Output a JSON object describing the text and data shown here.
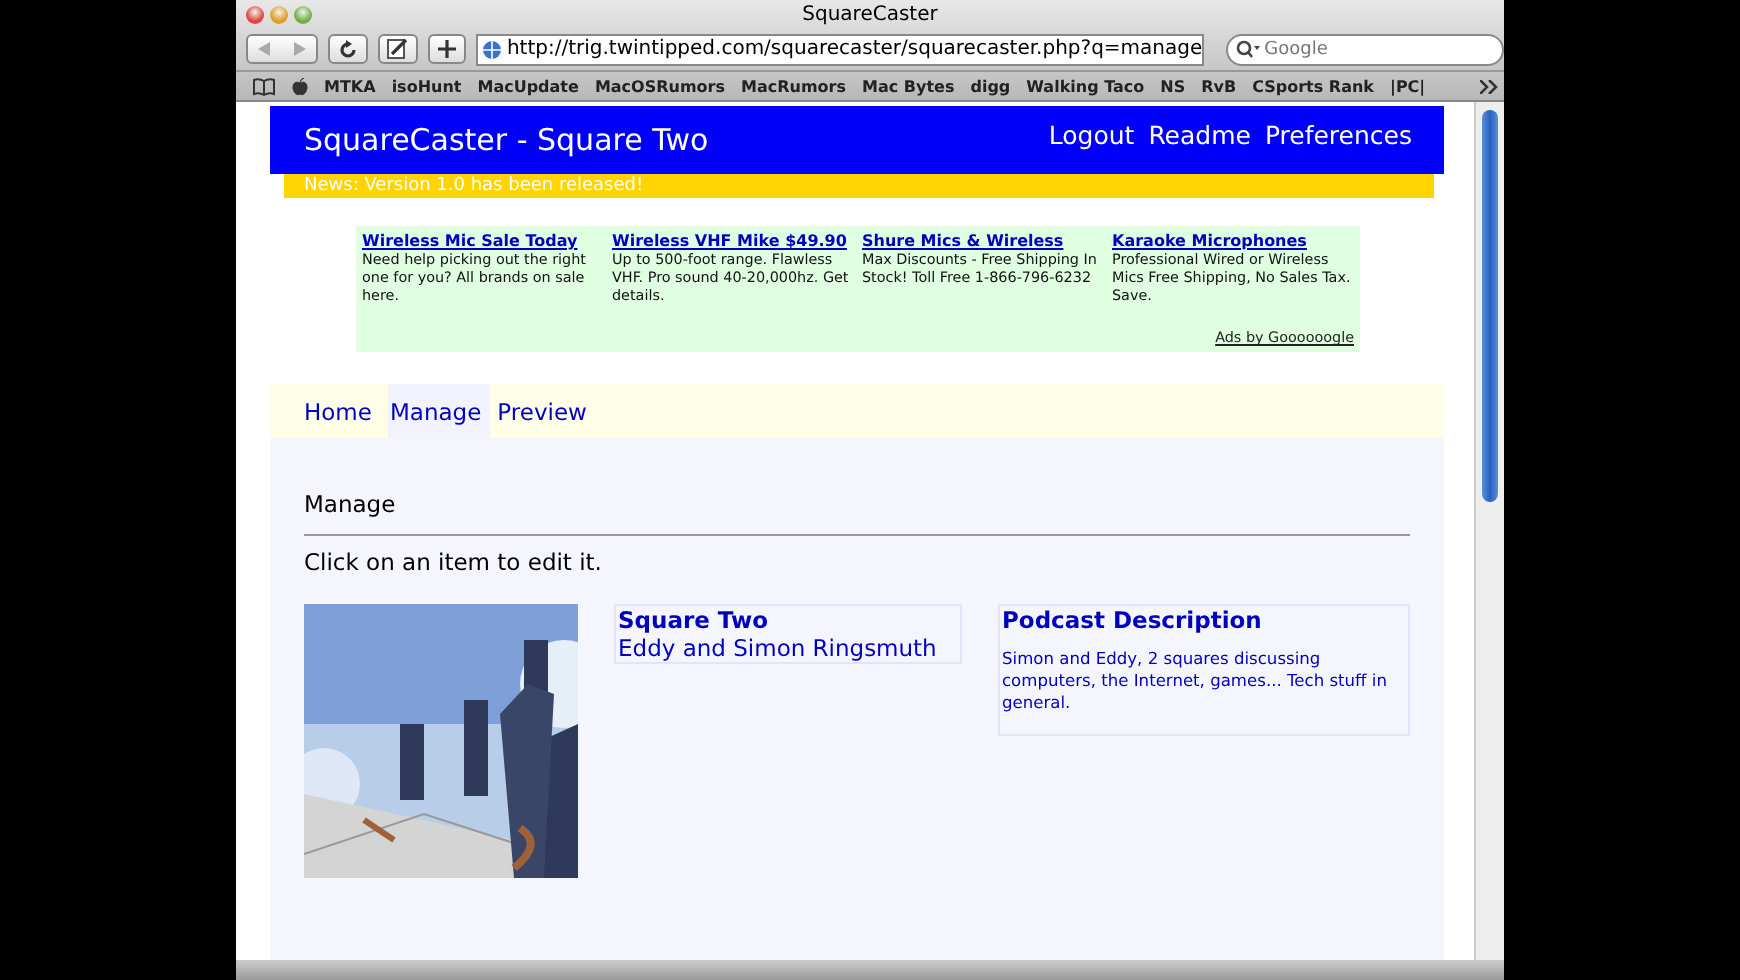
{
  "window": {
    "title": "SquareCaster"
  },
  "toolbar": {
    "address": "http://trig.twintipped.com/squarecaster/squarecaster.php?q=manage",
    "search": {
      "placeholder": "Google"
    }
  },
  "bookmarks": [
    "MTKA",
    "isoHunt",
    "MacUpdate",
    "MacOSRumors",
    "MacRumors",
    "Mac Bytes",
    "digg",
    "Walking Taco",
    "NS",
    "RvB",
    "CSports Rank",
    "|PC|"
  ],
  "header": {
    "title": "SquareCaster - Square Two",
    "links": [
      "Logout",
      "Readme",
      "Preferences"
    ]
  },
  "news": "News: Version 1.0 has been released!",
  "ads": [
    {
      "title": "Wireless Mic Sale Today",
      "text": "Need help picking out the right one for you? All brands on sale here."
    },
    {
      "title": "Wireless VHF Mike $49.90",
      "text": "Up to 500-foot range. Flawless VHF. Pro sound 40-20,000hz. Get details."
    },
    {
      "title": "Shure Mics & Wireless",
      "text": "Max Discounts - Free Shipping In Stock! Toll Free 1-866-796-6232"
    },
    {
      "title": "Karaoke Microphones",
      "text": "Professional Wired or Wireless Mics Free Shipping, No Sales Tax. Save."
    }
  ],
  "ads_by": "Ads by Goooooogle",
  "nav": [
    {
      "label": "Home",
      "selected": false
    },
    {
      "label": "Manage",
      "selected": true
    },
    {
      "label": "Preview",
      "selected": false
    }
  ],
  "section": {
    "heading": "Manage",
    "instruction": "Click on an item to edit it."
  },
  "podcast": {
    "title": "Square Two",
    "author": "Eddy and Simon Ringsmuth",
    "description_heading": "Podcast Description",
    "description": "Simon and Eddy, 2 squares discussing computers, the Internet, games... Tech stuff in general."
  }
}
